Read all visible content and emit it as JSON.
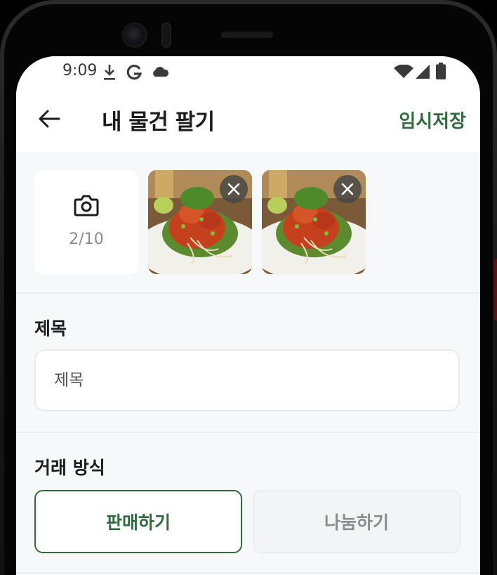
{
  "status_bar": {
    "time": "9:09",
    "icons": [
      "download-icon",
      "google-icon",
      "cloud-icon",
      "wifi-icon",
      "signal-icon",
      "battery-icon"
    ]
  },
  "app_bar": {
    "back_icon": "arrow-left-icon",
    "title": "내 물건 팔기",
    "temp_save_label": "임시저장"
  },
  "photos": {
    "count_label": "2/10",
    "camera_icon": "camera-icon",
    "items": [
      {
        "remove_icon": "close-icon"
      },
      {
        "remove_icon": "close-icon"
      }
    ]
  },
  "title_field": {
    "label": "제목",
    "placeholder": "제목",
    "value": ""
  },
  "trade_type": {
    "label": "거래 방식",
    "options": [
      "판매하기",
      "나눔하기"
    ],
    "selected": "판매하기"
  },
  "colors": {
    "accent": "#2f6b3d",
    "background": "#f7f8fa",
    "surface": "#ffffff",
    "muted_text": "#8c8c8c"
  }
}
